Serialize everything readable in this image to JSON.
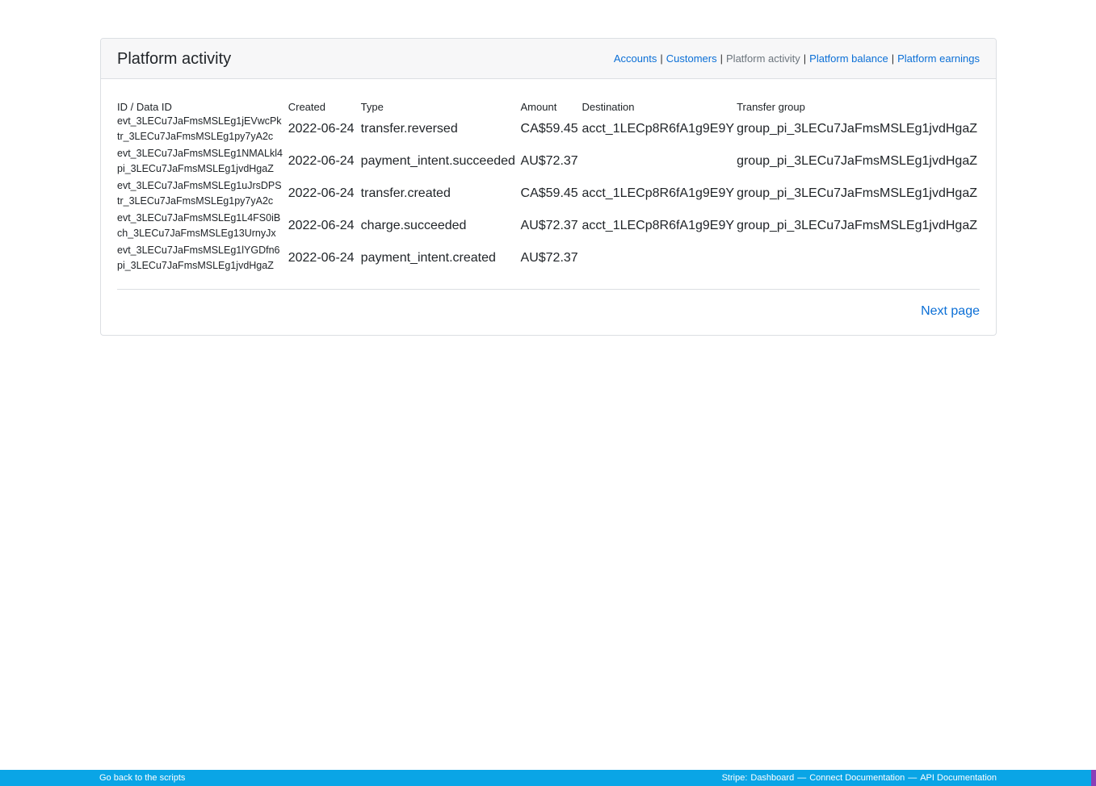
{
  "header": {
    "title": "Platform activity",
    "nav": [
      {
        "label": "Accounts",
        "link": true
      },
      {
        "label": "Customers",
        "link": true
      },
      {
        "label": "Platform activity",
        "link": false
      },
      {
        "label": "Platform balance",
        "link": true
      },
      {
        "label": "Platform earnings",
        "link": true
      }
    ],
    "separator": "|"
  },
  "table": {
    "columns": [
      "ID / Data ID",
      "Created",
      "Type",
      "Amount",
      "Destination",
      "Transfer group"
    ],
    "rows": [
      {
        "id": "evt_3LECu7JaFmsMSLEg1jEVwcPk",
        "data_id": "tr_3LECu7JaFmsMSLEg1py7yA2c",
        "created": "2022-06-24",
        "type": "transfer.reversed",
        "amount": "CA$59.45",
        "destination": "acct_1LECp8R6fA1g9E9Y",
        "group": "group_pi_3LECu7JaFmsMSLEg1jvdHgaZ"
      },
      {
        "id": "evt_3LECu7JaFmsMSLEg1NMALkl4",
        "data_id": "pi_3LECu7JaFmsMSLEg1jvdHgaZ",
        "created": "2022-06-24",
        "type": "payment_intent.succeeded",
        "amount": "AU$72.37",
        "destination": "",
        "group": "group_pi_3LECu7JaFmsMSLEg1jvdHgaZ"
      },
      {
        "id": "evt_3LECu7JaFmsMSLEg1uJrsDPS",
        "data_id": "tr_3LECu7JaFmsMSLEg1py7yA2c",
        "created": "2022-06-24",
        "type": "transfer.created",
        "amount": "CA$59.45",
        "destination": "acct_1LECp8R6fA1g9E9Y",
        "group": "group_pi_3LECu7JaFmsMSLEg1jvdHgaZ"
      },
      {
        "id": "evt_3LECu7JaFmsMSLEg1L4FS0iB",
        "data_id": "ch_3LECu7JaFmsMSLEg13UrnyJx",
        "created": "2022-06-24",
        "type": "charge.succeeded",
        "amount": "AU$72.37",
        "destination": "acct_1LECp8R6fA1g9E9Y",
        "group": "group_pi_3LECu7JaFmsMSLEg1jvdHgaZ"
      },
      {
        "id": "evt_3LECu7JaFmsMSLEg1lYGDfn6",
        "data_id": "pi_3LECu7JaFmsMSLEg1jvdHgaZ",
        "created": "2022-06-24",
        "type": "payment_intent.created",
        "amount": "AU$72.37",
        "destination": "",
        "group": ""
      }
    ]
  },
  "pager": {
    "next_label": "Next page"
  },
  "footer": {
    "back_label": "Go back to the scripts",
    "prefix": "Stripe:",
    "links": [
      "Dashboard",
      "Connect Documentation",
      "API Documentation"
    ],
    "dash": "—"
  },
  "colors": {
    "link": "#0b6fd6",
    "footer_bg": "#0aa5e6",
    "header_bg": "#f7f7f8"
  }
}
